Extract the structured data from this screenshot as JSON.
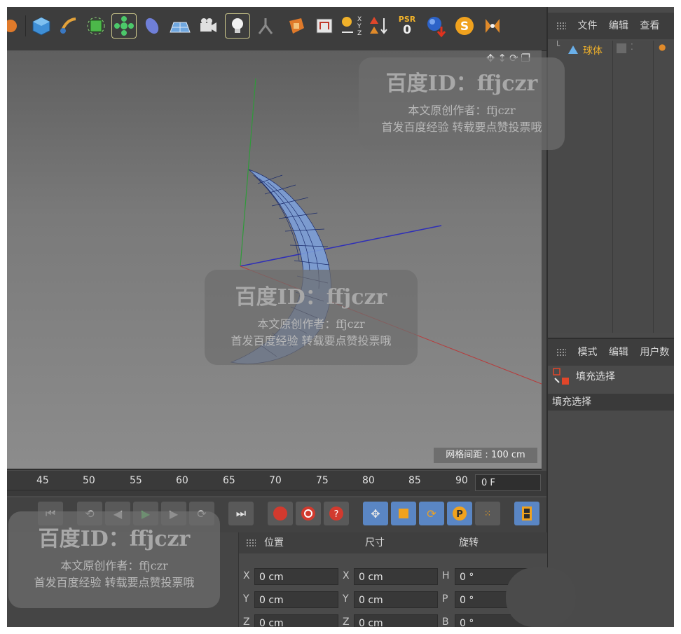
{
  "toolbar": {
    "icons": [
      "cube-icon",
      "pen-icon",
      "subdivision-icon",
      "cloner-icon",
      "deformer-icon",
      "floor-icon",
      "camera-icon",
      "light-icon",
      "character-icon",
      "render-icon",
      "render-settings-icon",
      "xyz-axis-icon",
      "transform-icon",
      "psr-icon",
      "sphere-icon",
      "snap-icon",
      "symmetry-icon"
    ],
    "psr_label": "PSR",
    "psr_value": "0",
    "axis_x": "X",
    "axis_y": "Y",
    "axis_z": "Z"
  },
  "viewport": {
    "grid_spacing": "网格间距 : 100 cm"
  },
  "object_manager": {
    "menu": [
      "文件",
      "编辑",
      "查看"
    ],
    "object_name": "球体"
  },
  "attribute_manager": {
    "menu": [
      "模式",
      "编辑",
      "用户数"
    ],
    "tool_name": "填充选择",
    "section_title": "填充选择"
  },
  "timeline": {
    "ticks": [
      "45",
      "50",
      "55",
      "60",
      "65",
      "70",
      "75",
      "80",
      "85",
      "90"
    ],
    "current_frame": "0 F"
  },
  "coordinates": {
    "headers": [
      "位置",
      "尺寸",
      "旋转"
    ],
    "position": [
      {
        "axis": "X",
        "value": "0 cm"
      },
      {
        "axis": "Y",
        "value": "0 cm"
      },
      {
        "axis": "Z",
        "value": "0 cm"
      }
    ],
    "size": [
      {
        "axis": "X",
        "value": "0 cm"
      },
      {
        "axis": "Y",
        "value": "0 cm"
      },
      {
        "axis": "Z",
        "value": "0 cm"
      }
    ],
    "rotation": [
      {
        "axis": "H",
        "value": "0 °"
      },
      {
        "axis": "P",
        "value": "0 °"
      },
      {
        "axis": "B",
        "value": "0 °"
      }
    ]
  },
  "watermark": {
    "title": "百度ID：ffjczr",
    "line2": "本文原创作者：ffjczr",
    "line3": "首发百度经验 转载要点赞投票哦"
  }
}
